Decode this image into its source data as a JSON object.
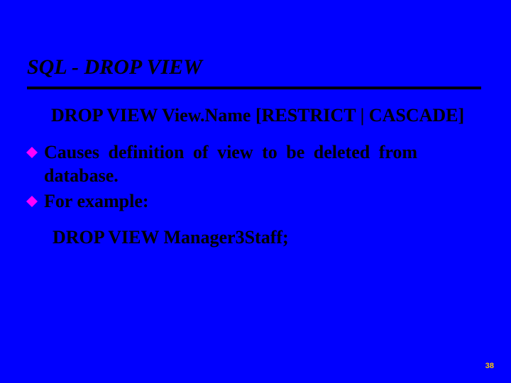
{
  "slide": {
    "title": "SQL - DROP VIEW",
    "syntax": "DROP VIEW View.Name [RESTRICT | CASCADE]",
    "bullets": [
      {
        "text_part1": "Causes definition of view to be deleted from",
        "text_part2": "database."
      },
      {
        "text_single": "For example:"
      }
    ],
    "example": "DROP VIEW Manager3Staff;",
    "page_number": "38"
  }
}
